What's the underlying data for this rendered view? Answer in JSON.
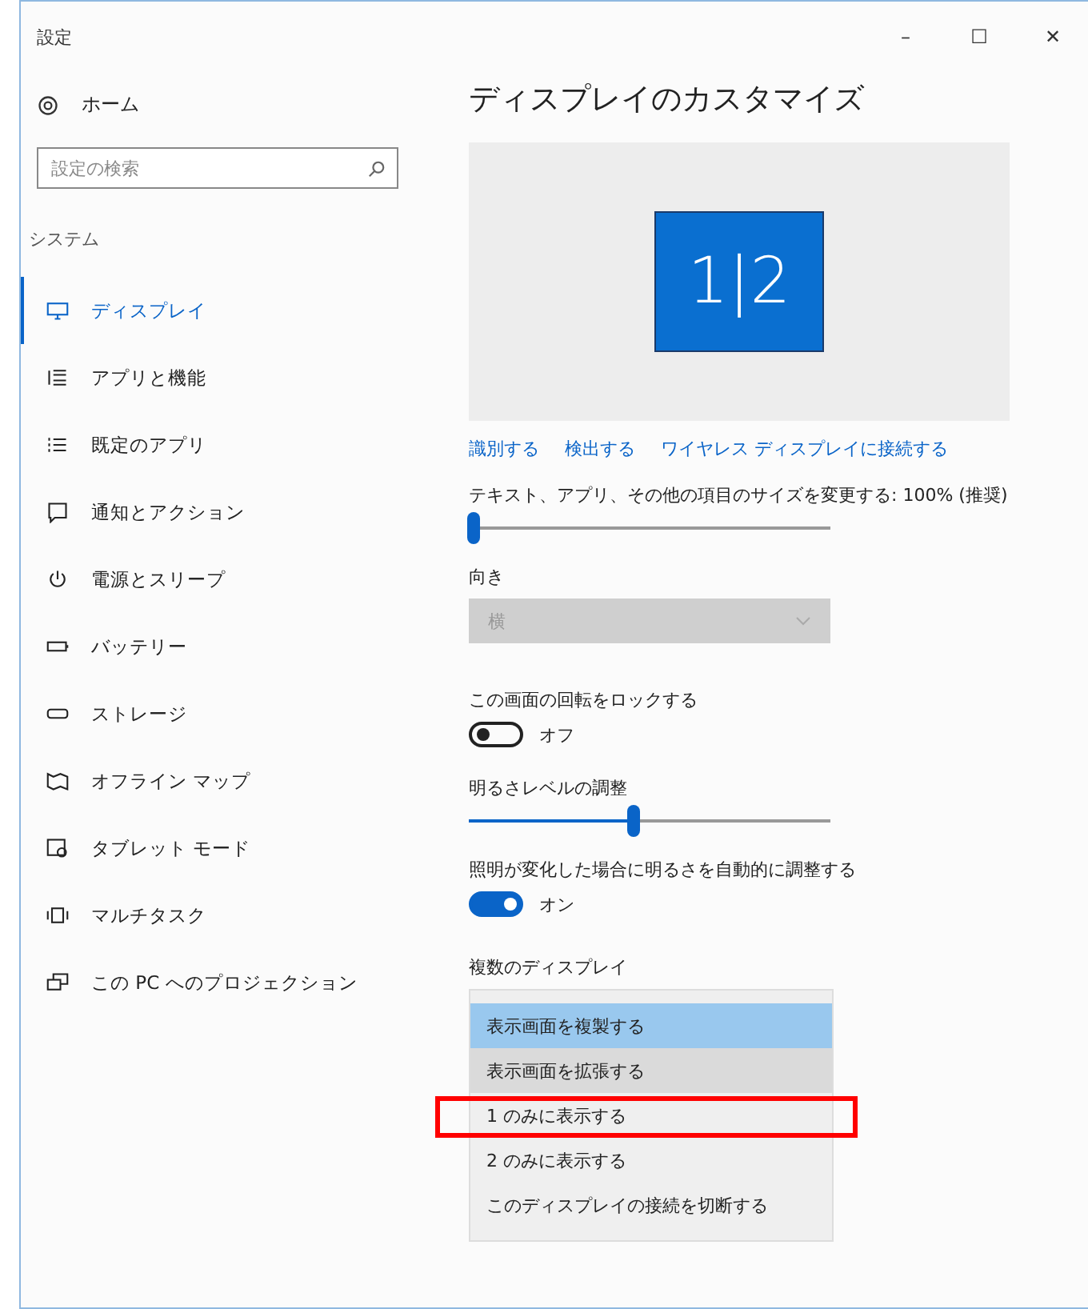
{
  "window": {
    "title": "設定",
    "controls": [
      "–",
      "☐",
      "✕"
    ]
  },
  "sidebar": {
    "home": "ホーム",
    "search": {
      "placeholder": "設定の検索"
    },
    "section": "システム",
    "items": [
      {
        "label": "ディスプレイ",
        "selected": true
      },
      {
        "label": "アプリと機能",
        "selected": false
      },
      {
        "label": "既定のアプリ",
        "selected": false
      },
      {
        "label": "通知とアクション",
        "selected": false
      },
      {
        "label": "電源とスリープ",
        "selected": false
      },
      {
        "label": "バッテリー",
        "selected": false
      },
      {
        "label": "ストレージ",
        "selected": false
      },
      {
        "label": "オフライン マップ",
        "selected": false
      },
      {
        "label": "タブレット モード",
        "selected": false
      },
      {
        "label": "マルチタスク",
        "selected": false
      },
      {
        "label": "この PC へのプロジェクション",
        "selected": false
      }
    ]
  },
  "content": {
    "title": "ディスプレイのカスタマイズ",
    "monitor_label": "1|2",
    "links": [
      "識別する",
      "検出する",
      "ワイヤレス ディスプレイに接続する"
    ],
    "scale": {
      "label": "テキスト、アプリ、その他の項目のサイズを変更する: 100% (推奨)",
      "level": 0.0
    },
    "orientation": {
      "label": "向き",
      "value": "横",
      "disabled": true
    },
    "rotation_lock": {
      "label": "この画面の回転をロックする",
      "on": false,
      "state_text": "オフ"
    },
    "brightness": {
      "label": "明るさレベルの調整",
      "level": 0.46
    },
    "auto_brightness": {
      "label": "照明が変化した場合に明るさを自動的に調整する",
      "on": true,
      "state_text": "オン"
    },
    "multiple_displays": {
      "label": "複数のディスプレイ",
      "options": [
        {
          "label": "表示画面を複製する",
          "selected": true,
          "hovered": false
        },
        {
          "label": "表示画面を拡張する",
          "selected": false,
          "hovered": true
        },
        {
          "label": "1 のみに表示する",
          "selected": false,
          "hovered": false,
          "annotated": true
        },
        {
          "label": "2 のみに表示する",
          "selected": false,
          "hovered": false,
          "annotated": false
        },
        {
          "label": "このディスプレイの接続を切断する",
          "selected": false,
          "hovered": false
        }
      ]
    }
  }
}
